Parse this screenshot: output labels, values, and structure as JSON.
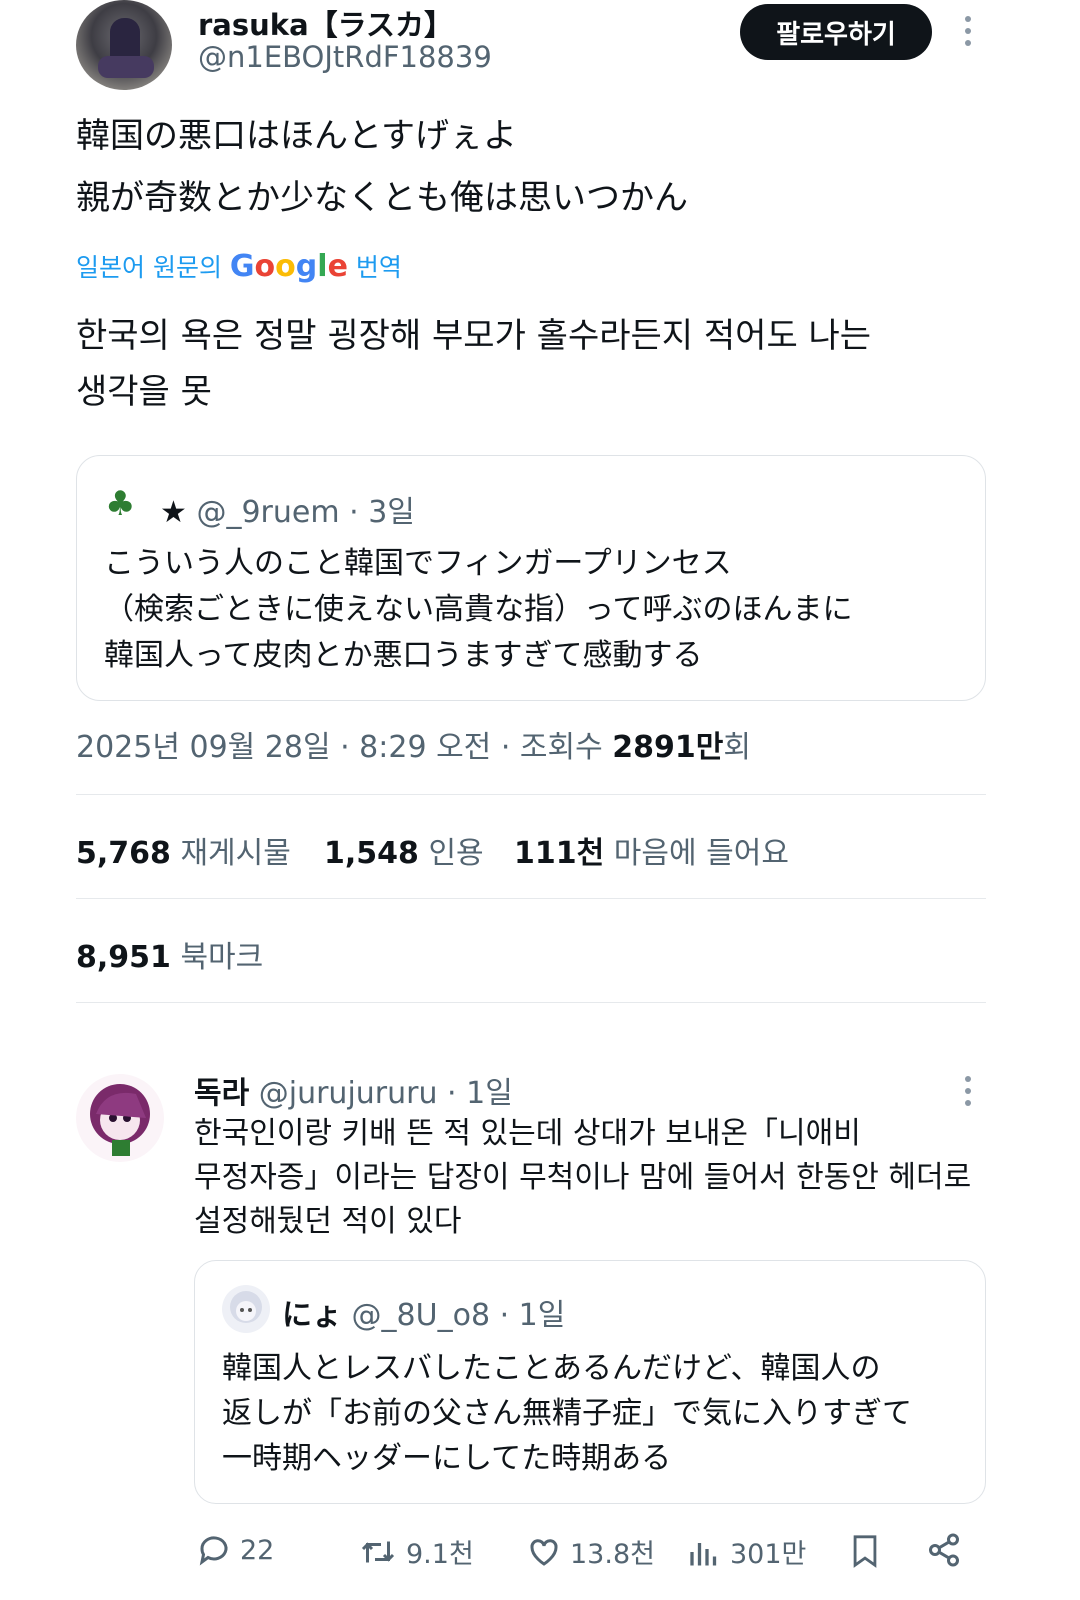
{
  "tweet": {
    "author_name": "rasuka【ラスカ】",
    "author_handle": "@n1EBOJtRdF18839",
    "follow_label": "팔로우하기",
    "text_lines": [
      "韓国の悪口はほんとすげぇよ",
      "親が奇数とか少なくとも俺は思いつかん"
    ],
    "translate_prefix": "일본어 원문의",
    "translate_brand": "Google",
    "translate_suffix": "번역",
    "translation_lines": [
      "한국의 욕은 정말 굉장해 부모가 홀수라든지 적어도 나는",
      "생각을 못"
    ]
  },
  "quoted": {
    "star": "★",
    "handle": "@_9ruem",
    "time": "· 3일",
    "lines": [
      "こういう人のこと韓国でフィンガープリンセス",
      "（検索ごときに使えない高貴な指）って呼ぶのほんまに",
      "韓国人って皮肉とか悪口うますぎて感動する"
    ]
  },
  "meta": {
    "date_time": "2025년 09월 28일 · 8:29 오전 · 조회수",
    "views_number": "2891만",
    "views_unit": "회"
  },
  "stats": {
    "reposts_value": "5,768",
    "reposts_label": "재게시물",
    "quotes_value": "1,548",
    "quotes_label": "인용",
    "likes_value": "111천",
    "likes_label": "마음에 들어요",
    "bookmarks_value": "8,951",
    "bookmarks_label": "북마크"
  },
  "reply": {
    "name": "독라",
    "handle": "@jurujururu",
    "time": "· 1일",
    "lines": [
      "한국인이랑 키배 뜬 적 있는데 상대가 보내온「니애비",
      "무정자증」이라는 답장이 무척이나 맘에 들어서 한동안 헤더로",
      "설정해뒀던 적이 있다"
    ],
    "nested": {
      "name": "にょ",
      "handle": "@_8U_o8",
      "time": "· 1일",
      "lines": [
        "韓国人とレスバしたことあるんだけど、韓国人の",
        "返しが「お前の父さん無精子症」で気に入りすぎて",
        "一時期ヘッダーにしてた時期ある"
      ]
    },
    "actions": {
      "replies": "22",
      "reposts": "9.1천",
      "likes": "13.8천",
      "views": "301만"
    }
  },
  "icons": {
    "reply": "comment-icon",
    "repost": "repost-icon",
    "like": "heart-icon",
    "views": "views-icon",
    "bookmark": "bookmark-icon",
    "share": "share-icon"
  },
  "colors": {
    "link_blue": "#1d9bf0",
    "muted_text": "#536471",
    "follow_button": "#0f1419"
  }
}
